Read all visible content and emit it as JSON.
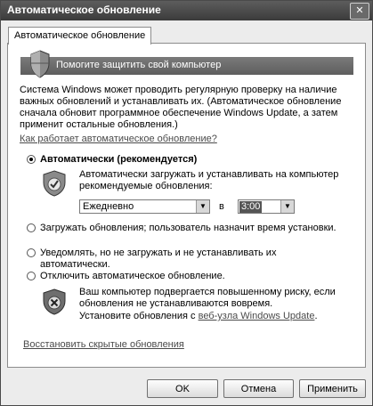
{
  "window": {
    "title": "Автоматическое обновление",
    "close_glyph": "✕"
  },
  "tab": {
    "label": "Автоматическое обновление"
  },
  "banner": {
    "text": "Помогите защитить свой компьютер"
  },
  "description": "Система Windows может проводить регулярную проверку на наличие важных обновлений и устанавливать их. (Автоматическое обновление сначала обновит программное обеспечение Windows Update, а затем применит остальные обновления.)",
  "how_link": "Как работает автоматическое обновление?",
  "options": {
    "auto": {
      "label": "Автоматически (рекомендуется)",
      "selected": true,
      "sub_text": "Автоматически загружать и устанавливать на компьютер рекомендуемые обновления:",
      "frequency": "Ежедневно",
      "at_label": "в",
      "time": "3:00"
    },
    "download": {
      "label": "Загружать обновления; пользователь назначит время установки.",
      "selected": false
    },
    "notify": {
      "label": "Уведомлять, но не загружать и не устанавливать их автоматически.",
      "selected": false
    },
    "off": {
      "label": "Отключить автоматическое обновление.",
      "selected": false,
      "warning": "Ваш компьютер подвергается повышенному риску, если обновления не устанавливаются вовремя.",
      "install_prefix": "Установите обновления с ",
      "install_link": "веб-узла Windows Update",
      "install_suffix": "."
    }
  },
  "restore_link": "Восстановить скрытые обновления",
  "buttons": {
    "ok": "OK",
    "cancel": "Отмена",
    "apply": "Применить"
  },
  "icons": {
    "banner": "shield-icon",
    "auto": "shield-check-icon",
    "off": "shield-x-icon"
  },
  "colors": {
    "titlebar": "#4a4a4a",
    "banner": "#6b6b6b",
    "link": "#4a4a4a"
  }
}
